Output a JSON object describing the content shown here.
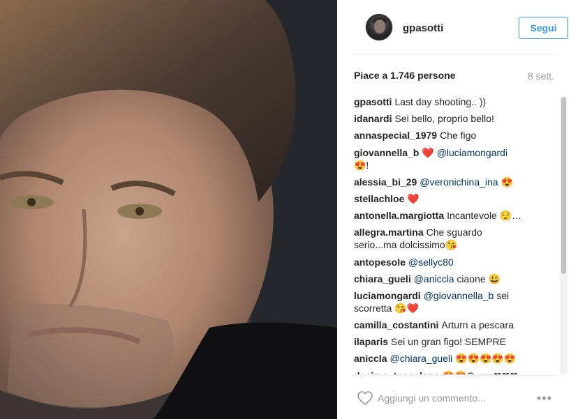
{
  "post": {
    "username": "gpasotti",
    "follow_label": "Segui",
    "likes_text": "Piace a 1.746 persone",
    "time_ago": "8 sett."
  },
  "comments": [
    {
      "user": "gpasotti",
      "text": "Last day shooting.. ))"
    },
    {
      "user": "idanardi",
      "text": "Sei bello, proprio bello!"
    },
    {
      "user": "annaspecial_1979",
      "text": "Che figo"
    },
    {
      "user": "giovannella_b",
      "text": "❤️ @luciamongardi 😍!",
      "mention": "@luciamongardi"
    },
    {
      "user": "alessia_bi_29",
      "text": "@veronichina_ina 😍",
      "mention": "@veronichina_ina"
    },
    {
      "user": "stellachloe",
      "text": "❤️"
    },
    {
      "user": "antonella.margiotta",
      "text": "Incantevole 😌…"
    },
    {
      "user": "allegra.martina",
      "text": "Che sguardo serio...ma dolcissimo😘"
    },
    {
      "user": "antopesole",
      "text": "@sellyc80",
      "mention": "@sellyc80"
    },
    {
      "user": "chiara_gueli",
      "text": "@aniccla ciaone 😃",
      "mention": "@aniccla"
    },
    {
      "user": "luciamongardi",
      "text": "@giovannella_b sei scorretta 😘❤️",
      "mention": "@giovannella_b"
    },
    {
      "user": "camilla_costantini",
      "text": "Arturn a pescara"
    },
    {
      "user": "ilaparis",
      "text": "Sei un gran figo! SEMPRE"
    },
    {
      "user": "aniccla",
      "text": "@chiara_gueli 😍😍😍😍😍",
      "mention": "@chiara_gueli"
    },
    {
      "user": "decimo_tuscolano",
      "text": "😍😍Cuore❤❤❤"
    }
  ],
  "footer": {
    "comment_placeholder": "Aggiungi un commento...",
    "more_icon": "•••"
  },
  "colors": {
    "accent": "#3897f0",
    "mention": "#003569",
    "heart": "#e0245e",
    "muted": "#999999"
  }
}
